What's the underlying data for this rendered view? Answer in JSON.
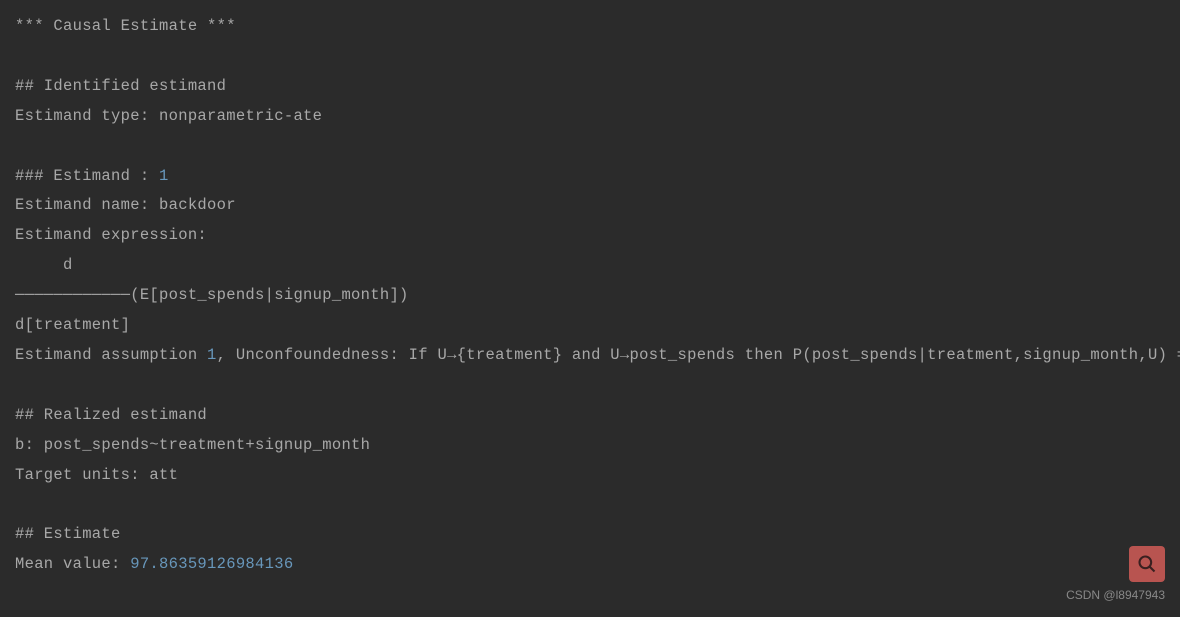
{
  "output": {
    "header": "*** Causal Estimate ***",
    "section1_title": "## Identified estimand",
    "estimand_type_label": "Estimand type: ",
    "estimand_type_value": "nonparametric-ate",
    "estimand_header": "### Estimand : ",
    "estimand_num": "1",
    "estimand_name_label": "Estimand name: ",
    "estimand_name_value": "backdoor",
    "estimand_expr_label": "Estimand expression:",
    "expr_numerator": "     d                                   ",
    "expr_divider": "────────────(E[post_spends|signup_month])",
    "expr_denominator": "d[treatment]                             ",
    "assumption_prefix": "Estimand assumption ",
    "assumption_num": "1",
    "assumption_text": ", Unconfoundedness: If U→{treatment} and U→post_spends then P(post_spends|treatment,signup_month,U) = P(post_spends|treatment,signup_month)",
    "section2_title": "## Realized estimand",
    "realized_formula": "b: post_spends~treatment+signup_month",
    "target_units_label": "Target units: ",
    "target_units_value": "att",
    "section3_title": "## Estimate",
    "mean_label": "Mean value: ",
    "mean_value": "97.86359126984136"
  },
  "watermark": "CSDN @l8947943"
}
